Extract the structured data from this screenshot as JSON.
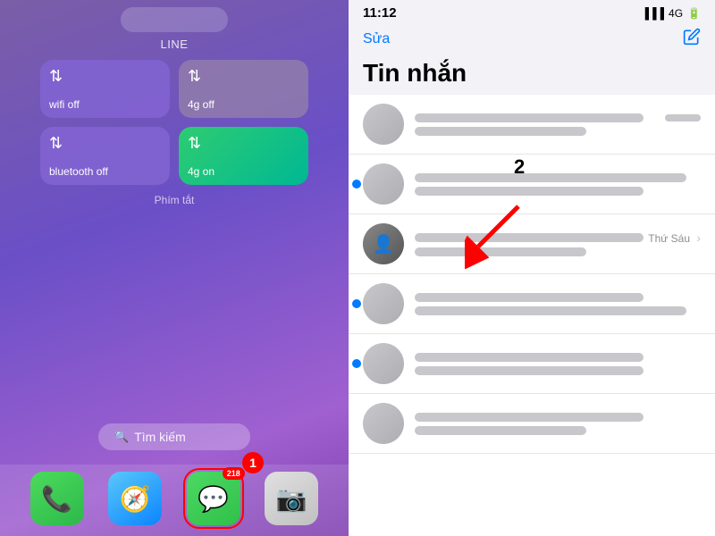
{
  "left": {
    "app_name": "LINE",
    "shortcuts": [
      {
        "id": "wifi",
        "label": "wifi off",
        "type": "purple"
      },
      {
        "id": "4g_off",
        "label": "4g off",
        "type": "gray"
      },
      {
        "id": "bluetooth",
        "label": "bluetooth off",
        "type": "purple"
      },
      {
        "id": "4g_on",
        "label": "4g on",
        "type": "green"
      }
    ],
    "phim_tat": "Phím tắt",
    "search_label": "Tìm kiếm",
    "step1_badge": "1",
    "dock": [
      {
        "id": "phone",
        "icon": "📞",
        "type": "phone",
        "label": "Phone"
      },
      {
        "id": "safari",
        "icon": "🧭",
        "type": "safari",
        "label": "Safari"
      },
      {
        "id": "messages",
        "icon": "💬",
        "type": "messages",
        "label": "Messages",
        "badge": "218",
        "highlighted": true
      },
      {
        "id": "camera",
        "icon": "📷",
        "type": "camera",
        "label": "Camera"
      }
    ]
  },
  "right": {
    "status": {
      "time": "11:12",
      "signal": "4G",
      "battery": "🔋"
    },
    "header": {
      "sua_label": "Sửa",
      "title": "Tin nhắn",
      "compose_icon": "✏️"
    },
    "step2_badge": "2",
    "messages": [
      {
        "id": 1,
        "name_blurred": true,
        "time": "",
        "preview_blurred": true,
        "unread": false,
        "has_photo": false
      },
      {
        "id": 2,
        "name_blurred": true,
        "time": "",
        "preview_blurred": true,
        "unread": true,
        "has_photo": false
      },
      {
        "id": 3,
        "name_blurred": true,
        "time": "Thứ Sáu",
        "preview_blurred": true,
        "unread": false,
        "has_photo": true
      },
      {
        "id": 4,
        "name_blurred": true,
        "time": "",
        "preview_blurred": true,
        "unread": true,
        "has_photo": false
      },
      {
        "id": 5,
        "name_blurred": true,
        "time": "",
        "preview_blurred": true,
        "unread": true,
        "has_photo": false
      },
      {
        "id": 6,
        "name_blurred": true,
        "time": "",
        "preview_blurred": true,
        "unread": false,
        "has_photo": false
      }
    ]
  }
}
